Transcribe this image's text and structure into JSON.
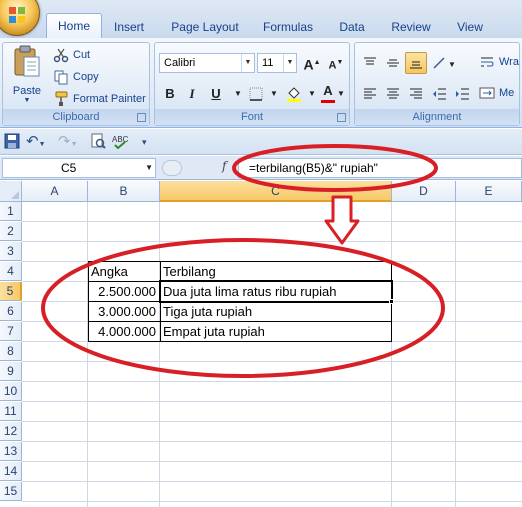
{
  "ribbon_tabs": [
    {
      "label": "Home",
      "active": true
    },
    {
      "label": "Insert",
      "active": false
    },
    {
      "label": "Page Layout",
      "active": false
    },
    {
      "label": "Formulas",
      "active": false
    },
    {
      "label": "Data",
      "active": false
    },
    {
      "label": "Review",
      "active": false
    },
    {
      "label": "View",
      "active": false
    }
  ],
  "clipboard": {
    "paste_label": "Paste",
    "cut_label": "Cut",
    "copy_label": "Copy",
    "format_painter_label": "Format Painter",
    "group_label": "Clipboard"
  },
  "font": {
    "font_name": "Calibri",
    "font_size": "11",
    "group_label": "Font",
    "bold": "B",
    "italic": "I",
    "underline": "U",
    "grow": "A",
    "shrink": "A",
    "font_color": "A"
  },
  "alignment": {
    "group_label": "Alignment",
    "wrap_label": "Wra",
    "merge_label": "Me"
  },
  "name_box": "C5",
  "fx_symbol": "f",
  "formula": "=terbilang(B5)&\" rupiah\"",
  "columns": [
    "A",
    "B",
    "C",
    "D",
    "E"
  ],
  "rows": [
    "1",
    "2",
    "3",
    "4",
    "5",
    "6",
    "7",
    "8",
    "9",
    "10",
    "11",
    "12",
    "13",
    "14",
    "15"
  ],
  "table": {
    "header_angka": "Angka",
    "header_terbilang": "Terbilang",
    "rows": [
      {
        "angka": "2.500.000",
        "terbilang": "Dua juta lima ratus ribu rupiah"
      },
      {
        "angka": "3.000.000",
        "terbilang": "Tiga juta rupiah"
      },
      {
        "angka": "4.000.000",
        "terbilang": "Empat juta rupiah"
      }
    ]
  },
  "colors": {
    "annotation_red": "#d91f26",
    "selected_header": "#f8c865"
  }
}
